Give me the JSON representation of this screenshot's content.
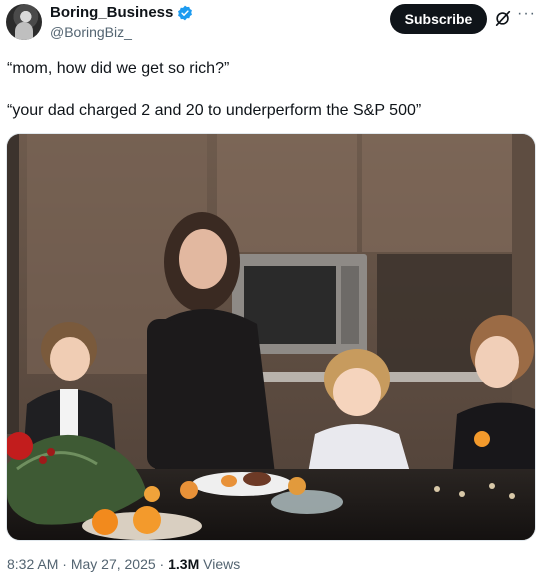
{
  "author": {
    "display_name": "Boring_Business",
    "handle": "@BoringBiz_",
    "verified_icon": "verified-badge-icon",
    "badge_color": "#1d9bf0"
  },
  "actions": {
    "subscribe_label": "Subscribe",
    "grok_icon": "grok-icon",
    "more_icon": "more-dots-icon"
  },
  "tweet": {
    "line1": "“mom, how did we get so rich?”",
    "line2": "“your dad charged 2 and 20 to underperform the S&P 500”"
  },
  "meta": {
    "time": "8:32 AM",
    "separator": " · ",
    "date": "May 27, 2025",
    "views_count": "1.3M",
    "views_label": " Views"
  }
}
